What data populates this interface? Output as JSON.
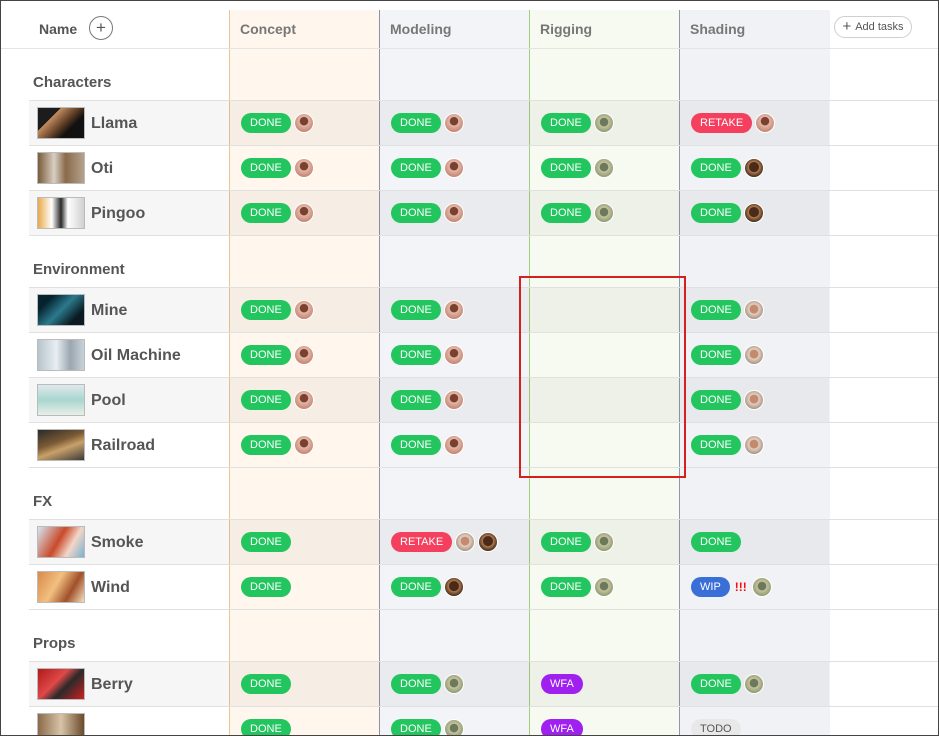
{
  "header": {
    "name_label": "Name",
    "add_icon": "+",
    "columns": [
      "Concept",
      "Modeling",
      "Rigging",
      "Shading"
    ],
    "add_tasks_label": "Add tasks",
    "add_tasks_icon": "+"
  },
  "sections": {
    "characters": {
      "title": "Characters",
      "rows": [
        {
          "name": "Llama",
          "concept": "DONE",
          "modeling": "DONE",
          "rigging": "DONE",
          "shading": "RETAKE"
        },
        {
          "name": "Oti",
          "concept": "DONE",
          "modeling": "DONE",
          "rigging": "DONE",
          "shading": "DONE"
        },
        {
          "name": "Pingoo",
          "concept": "DONE",
          "modeling": "DONE",
          "rigging": "DONE",
          "shading": "DONE"
        }
      ]
    },
    "environment": {
      "title": "Environment",
      "rows": [
        {
          "name": "Mine",
          "concept": "DONE",
          "modeling": "DONE",
          "shading": "DONE"
        },
        {
          "name": "Oil Machine",
          "concept": "DONE",
          "modeling": "DONE",
          "shading": "DONE"
        },
        {
          "name": "Pool",
          "concept": "DONE",
          "modeling": "DONE",
          "shading": "DONE"
        },
        {
          "name": "Railroad",
          "concept": "DONE",
          "modeling": "DONE",
          "shading": "DONE"
        }
      ]
    },
    "fx": {
      "title": "FX",
      "rows": [
        {
          "name": "Smoke",
          "concept": "DONE",
          "modeling": "RETAKE",
          "rigging": "DONE",
          "shading": "DONE"
        },
        {
          "name": "Wind",
          "concept": "DONE",
          "modeling": "DONE",
          "rigging": "DONE",
          "shading": "WIP",
          "shading_flag": "!!!"
        }
      ]
    },
    "props": {
      "title": "Props",
      "rows": [
        {
          "name": "Berry",
          "concept": "DONE",
          "modeling": "DONE",
          "rigging": "WFA",
          "shading": "DONE"
        },
        {
          "name": "",
          "concept": "DONE",
          "modeling": "DONE",
          "rigging": "WFA",
          "shading": "TODO"
        }
      ]
    }
  },
  "colors": {
    "done": "#22c55e",
    "retake": "#f43f5e",
    "wip": "#3b6fd8",
    "wfa": "#a020f0",
    "todo": "#e8e8e8",
    "highlight": "#d61f1f"
  }
}
